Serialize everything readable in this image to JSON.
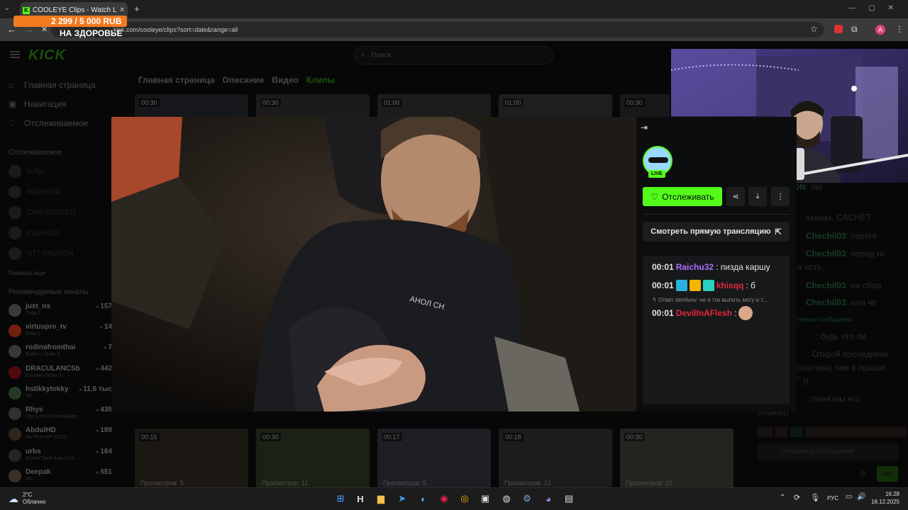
{
  "browser": {
    "tab_title": "COOLEYE Clips - Watch Live on",
    "url": "kick.com/cooleye/clips?sort=date&range=all",
    "avatar_letter": "A"
  },
  "donation": {
    "amount": "2 299 / 5 000 RUB",
    "caption": "НА ЗДОРОВЬЕ"
  },
  "kick": {
    "logo": "KICK",
    "search_placeholder": "Поиск",
    "nav": [
      {
        "label": "Главная страница",
        "icon": "home-icon"
      },
      {
        "label": "Навигация",
        "icon": "compass-icon"
      },
      {
        "label": "Отслеживаемое",
        "icon": "heart-icon"
      }
    ],
    "followed_header": "Отслеживаемое",
    "followed": [
      "bullyn",
      "КОМНАТА",
      "CHIPSOSOSTI",
      "PapaHOD",
      "HTT PASSION"
    ],
    "show_more": "Показать еще",
    "recommended_header": "Рекомендуемые каналы",
    "recommended": [
      {
        "name": "just_ns",
        "game": "Dota 2",
        "viewers": "157",
        "color": "#5a5a5a"
      },
      {
        "name": "virtuspro_tv",
        "game": "Dota 2",
        "viewers": "14",
        "color": "#b0301a"
      },
      {
        "name": "rodinafromthai",
        "game": "Baldur's Gate 3",
        "viewers": "7",
        "color": "#555"
      },
      {
        "name": "DRACULANCSb",
        "game": "Counter-Strike 2",
        "viewers": "442",
        "color": "#7a1015"
      },
      {
        "name": "hstikkytokky",
        "game": "IRL",
        "viewers": "11,6 тыс",
        "color": "#3a5a3a"
      },
      {
        "name": "Rhys",
        "game": "Old School RuneScape",
        "viewers": "435",
        "color": "#4a4a4a"
      },
      {
        "name": "AbdulHD",
        "game": "No Pixel RP (GTA)",
        "viewers": "189",
        "color": "#4a3a2a"
      },
      {
        "name": "urbs",
        "game": "Grand Theft Auto V (G...",
        "viewers": "164",
        "color": "#3a3a3a"
      },
      {
        "name": "Deepak",
        "game": "IRL",
        "viewers": "551",
        "color": "#5a4a3a"
      }
    ],
    "channel_tabs": [
      "Главная страница",
      "Описание",
      "Видео",
      "Клипы"
    ],
    "top_clips": [
      "00:30",
      "00:30",
      "01:00",
      "01:00",
      "00:30"
    ],
    "bottom_clips": [
      {
        "duration": "00:15",
        "views": "Просмотров: 5"
      },
      {
        "duration": "00:30",
        "views": "Просмотров: 11"
      },
      {
        "duration": "00:17",
        "views": "Просмотров: 5"
      },
      {
        "duration": "00:18",
        "views": "Просмотров: 12"
      },
      {
        "duration": "00:30",
        "views": "Просмотров: 22"
      }
    ]
  },
  "bg_chat": {
    "lines": [
      {
        "user": "TTPASSION",
        "text": ": ляг"
      },
      {
        "user": "",
        "text": ": ахахах. CACHET"
      },
      {
        "user": "Chechil03",
        "text": ": сереге"
      },
      {
        "user": "Chechil03",
        "text": ": перед нг"
      },
      {
        "user": "",
        "text": "я есть"
      },
      {
        "user": "Chechil03",
        "text": ": на сбор"
      },
      {
        "user": "Chechil03",
        "text": ": или че"
      },
      {
        "user": "",
        "text": "Новые сообщения"
      },
      {
        "user": "",
        "text": ": будь что ли"
      },
      {
        "user": "",
        "text": ": Открой последнюю"
      },
      {
        "user": "",
        "text": "платона) там в правах"
      },
      {
        "user": "",
        "text": "\" ))"
      },
      {
        "user": "",
        "text": ": понятны его"
      },
      {
        "user": "",
        "text": "планы))"
      }
    ],
    "input_placeholder": "Отправить сообщение",
    "send_label": "Чат"
  },
  "clip_panel": {
    "live_label": "LIVE",
    "follow_label": "Отслеживать",
    "watch_live_label": "Смотреть прямую трансляцию",
    "messages": [
      {
        "time": "00:01",
        "user": "Raichu32",
        "user_color": "#a970ff",
        "text": ": пизда каршу",
        "badges": []
      },
      {
        "time": "00:01",
        "user": "khisqq",
        "user_color": "#e3273a",
        "text": ": б",
        "badges": [
          "#2ab0e0",
          "#f5b400",
          "#2ad0c0"
        ]
      },
      {
        "time": "00:01",
        "user": "DevilInAFlesh",
        "user_color": "#e3273a",
        "text": ":",
        "badges": []
      }
    ],
    "reply_text": "Ответ demluvv: не я ток выпить могу и т..."
  },
  "taskbar": {
    "weather_temp": "2°C",
    "weather_desc": "Облачно",
    "lang": "РУС",
    "time": "16:28",
    "date": "18.12.2025"
  }
}
